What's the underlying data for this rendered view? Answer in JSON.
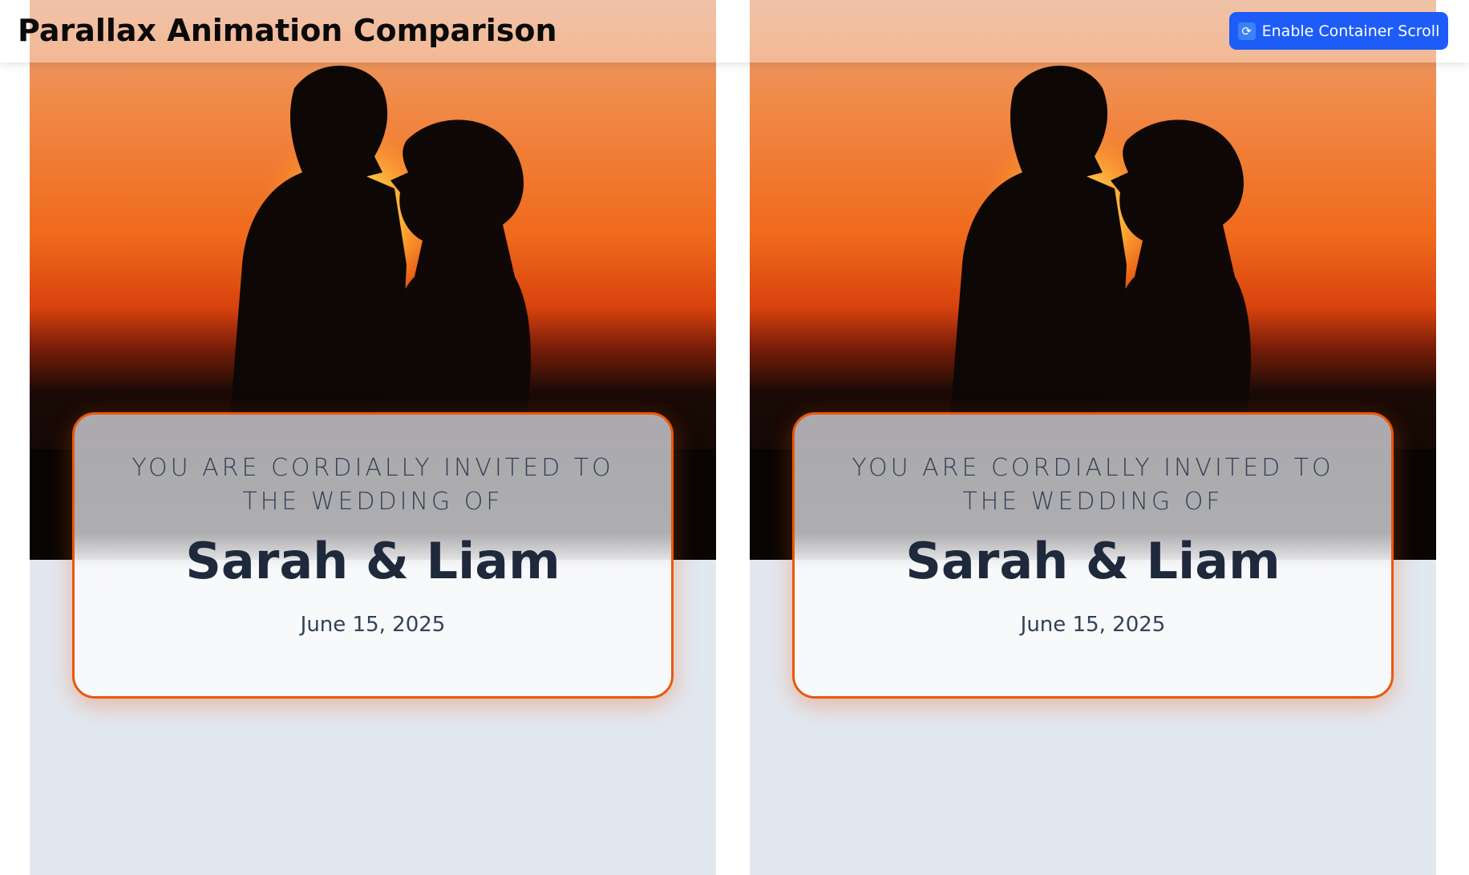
{
  "header": {
    "title": "Parallax Animation Comparison",
    "button_label": "Enable Container Scroll",
    "button_icon": "refresh-icon"
  },
  "panels": [
    {
      "intro": "YOU ARE CORDIALLY INVITED TO THE WEDDING OF",
      "names": "Sarah & Liam",
      "date": "June 15, 2025"
    },
    {
      "intro": "YOU ARE CORDIALLY INVITED TO THE WEDDING OF",
      "names": "Sarah & Liam",
      "date": "June 15, 2025"
    }
  ],
  "colors": {
    "accent": "#ea580c",
    "button": "#1d5cf6",
    "panel_bg": "#e2e8f0",
    "text_dark": "#1e293b"
  }
}
